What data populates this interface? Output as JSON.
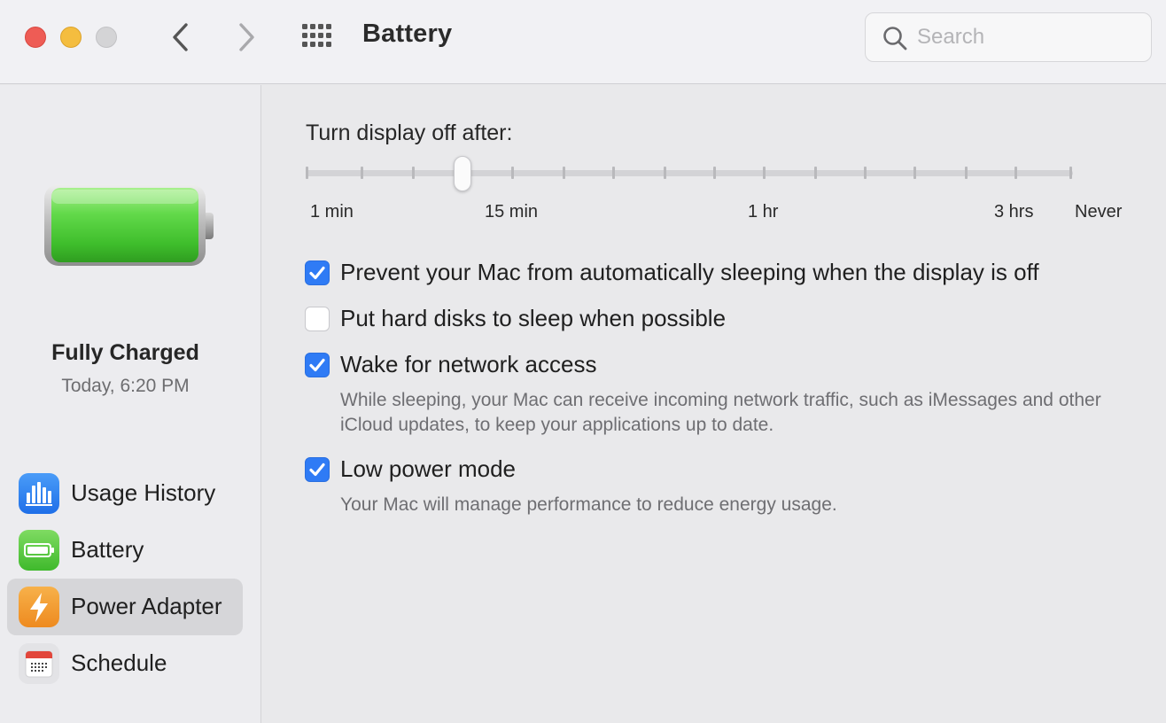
{
  "window": {
    "title": "Battery"
  },
  "colors": {
    "close": "#ee5c55",
    "minimize": "#f4bd3f",
    "zoom_inactive": "#d4d4d6",
    "accent": "#2f7bf5",
    "battery_fill": "#5ed444"
  },
  "toolbar": {
    "back_icon": "chevron-left-icon",
    "forward_icon": "chevron-right-icon",
    "grid_icon": "grid-icon"
  },
  "search": {
    "placeholder": "Search",
    "value": ""
  },
  "battery": {
    "status": "Fully Charged",
    "time": "Today, 6:20 PM",
    "level": 1.0
  },
  "sidebar": {
    "items": [
      {
        "label": "Usage History",
        "icon": "chart-icon",
        "selected": false
      },
      {
        "label": "Battery",
        "icon": "battery-icon",
        "selected": false
      },
      {
        "label": "Power Adapter",
        "icon": "bolt-icon",
        "selected": true
      },
      {
        "label": "Schedule",
        "icon": "calendar-icon",
        "selected": false
      }
    ]
  },
  "display_sleep": {
    "title": "Turn display off after:",
    "value": "10 min",
    "tick_labels": [
      "1 min",
      "15 min",
      "1 hr",
      "3 hrs",
      "Never"
    ]
  },
  "options": [
    {
      "label": "Prevent your Mac from automatically sleeping when the display is off",
      "checked": true,
      "description": ""
    },
    {
      "label": "Put hard disks to sleep when possible",
      "checked": false,
      "description": ""
    },
    {
      "label": "Wake for network access",
      "checked": true,
      "description": "While sleeping, your Mac can receive incoming network traffic, such as iMessages and other iCloud updates, to keep your applications up to date."
    },
    {
      "label": "Low power mode",
      "checked": true,
      "description": "Your Mac will manage performance to reduce energy usage."
    }
  ]
}
